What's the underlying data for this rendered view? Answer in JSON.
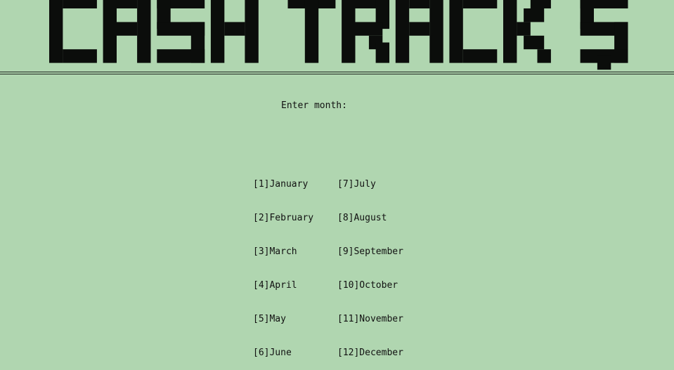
{
  "app": {
    "banner_text": "CASH TRACK $"
  },
  "prompt": {
    "label": "Enter month:"
  },
  "months": {
    "left": [
      "[1]January",
      "[2]February",
      "[3]March",
      "[4]April",
      "[5]May",
      "[6]June"
    ],
    "right": [
      "[7]July",
      "[8]August",
      "[9]September",
      "[10]October",
      "[11]November",
      "[12]December"
    ]
  },
  "colors": {
    "background": "#b0d6b0",
    "text": "#111111"
  }
}
